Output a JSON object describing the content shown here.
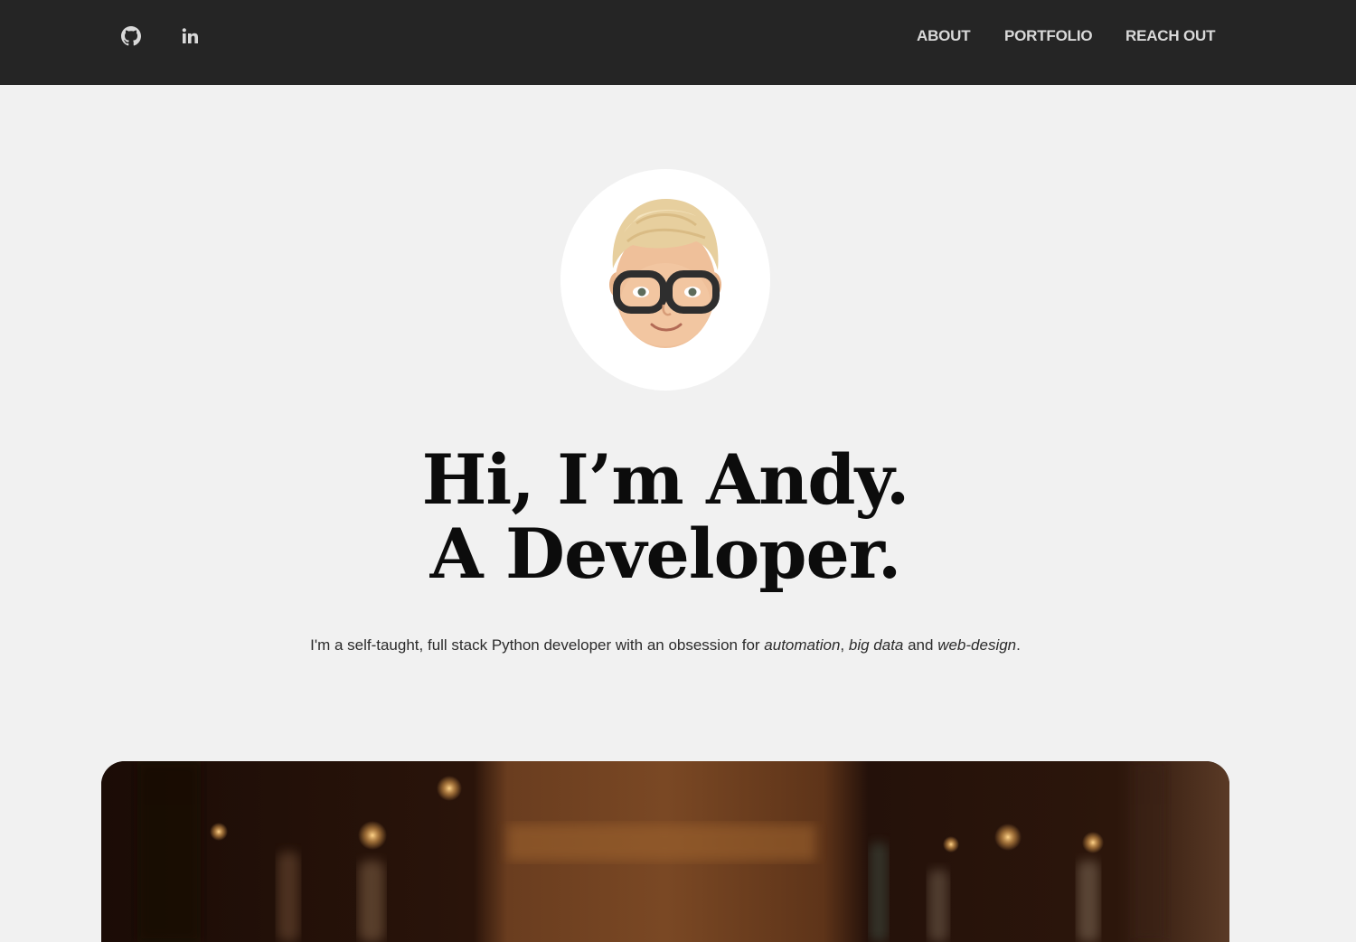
{
  "navbar": {
    "social": [
      {
        "icon": "github-icon"
      },
      {
        "icon": "linkedin-icon"
      }
    ],
    "links": [
      "ABOUT",
      "PORTFOLIO",
      "REACH OUT"
    ]
  },
  "hero": {
    "title_line1": "Hi, I’m Andy.",
    "title_line2": "A Developer.",
    "intro_prefix": "I'm a self-taught, full stack Python developer with an obsession for ",
    "intro_em1": "automation",
    "intro_sep1": ", ",
    "intro_em2": "big data",
    "intro_sep2": " and ",
    "intro_em3": "web-design",
    "intro_suffix": "."
  },
  "colors": {
    "navbar_bg": "#252525",
    "page_bg": "#f1f1f1",
    "nav_text": "#d9d9d9",
    "heading_text": "#0c0c0c"
  }
}
